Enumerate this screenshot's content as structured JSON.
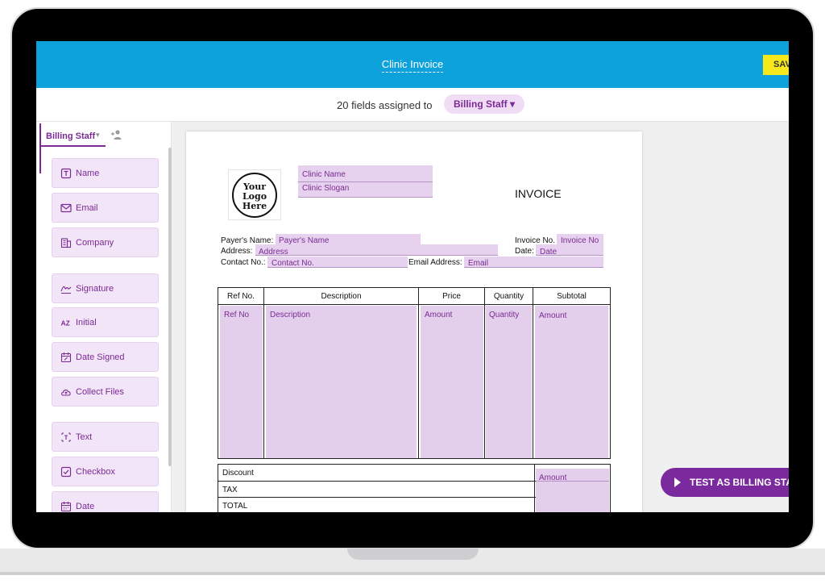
{
  "topbar": {
    "doc_title": "Clinic Invoice",
    "save_label": "SAV"
  },
  "assign": {
    "text": "20 fields assigned to",
    "role": "Billing Staff ▾"
  },
  "sidebar": {
    "role_tab": "Billing Staff",
    "caret": "▾",
    "fields": [
      {
        "label": "Name",
        "icon": "text-box-icon"
      },
      {
        "label": "Email",
        "icon": "envelope-icon"
      },
      {
        "label": "Company",
        "icon": "building-icon"
      },
      {
        "label": "Signature",
        "icon": "signature-icon"
      },
      {
        "label": "Initial",
        "icon": "initial-icon"
      },
      {
        "label": "Date Signed",
        "icon": "calendar-pen-icon"
      },
      {
        "label": "Collect Files",
        "icon": "cloud-upload-icon"
      },
      {
        "label": "Text",
        "icon": "text-cursor-icon"
      },
      {
        "label": "Checkbox",
        "icon": "checkbox-icon"
      },
      {
        "label": "Date",
        "icon": "calendar-icon"
      }
    ]
  },
  "document": {
    "logo_text": "Your Logo Here",
    "logo_line1": "Your",
    "logo_line2": "Logo",
    "logo_line3": "Here",
    "clinic_name": "Clinic Name",
    "clinic_slogan": "Clinic Slogan",
    "invoice_title": "INVOICE",
    "payer_name_label": "Payer's Name:",
    "payer_name_field": "Payer's Name",
    "address_label": "Address:",
    "address_field": "Address",
    "contact_label": "Contact No.:",
    "contact_field": "Contact No.",
    "invoice_no_label": "Invoice No.",
    "invoice_no_field": "Invoice No",
    "date_label": "Date:",
    "date_field": "Date",
    "email_label": "Email Address:",
    "email_field": "Email",
    "table": {
      "headers": [
        "Ref No.",
        "Description",
        "Price",
        "Quantity",
        "Subtotal"
      ],
      "fields": [
        "Ref No",
        "Description",
        "Amount",
        "Quantity",
        "Amount"
      ]
    },
    "summary": {
      "rows": [
        "Discount",
        "TAX",
        "TOTAL"
      ],
      "amount_field": "Amount"
    }
  },
  "test_button": {
    "label": "TEST AS BILLING STA"
  },
  "colors": {
    "brand_blue": "#0ea2dc",
    "accent_purple": "#7a2a93",
    "field_fill": "#e6d2ee",
    "save_yellow": "#f5e91d"
  }
}
